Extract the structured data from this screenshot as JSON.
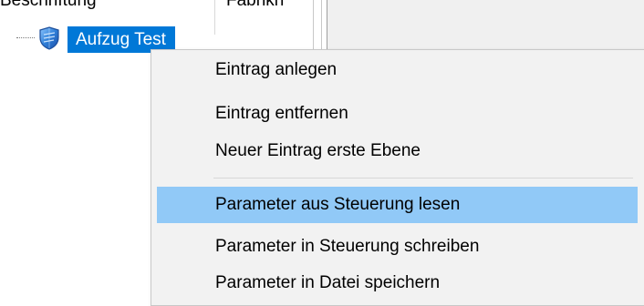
{
  "tree": {
    "columns": [
      "Beschriftung",
      "Fabrikn"
    ],
    "node": {
      "label": "Aufzug Test",
      "icon": "shield-icon"
    }
  },
  "context_menu": {
    "items": [
      "Eintrag anlegen",
      "Eintrag entfernen",
      "Neuer Eintrag erste Ebene",
      "Parameter aus Steuerung lesen",
      "Parameter in Steuerung schreiben",
      "Parameter in  Datei speichern"
    ],
    "highlighted_item": "Parameter aus Steuerung lesen"
  },
  "colors": {
    "selection": "#0078d7",
    "menu_highlight": "#91c9f7",
    "menu_background": "#f2f2f2"
  }
}
